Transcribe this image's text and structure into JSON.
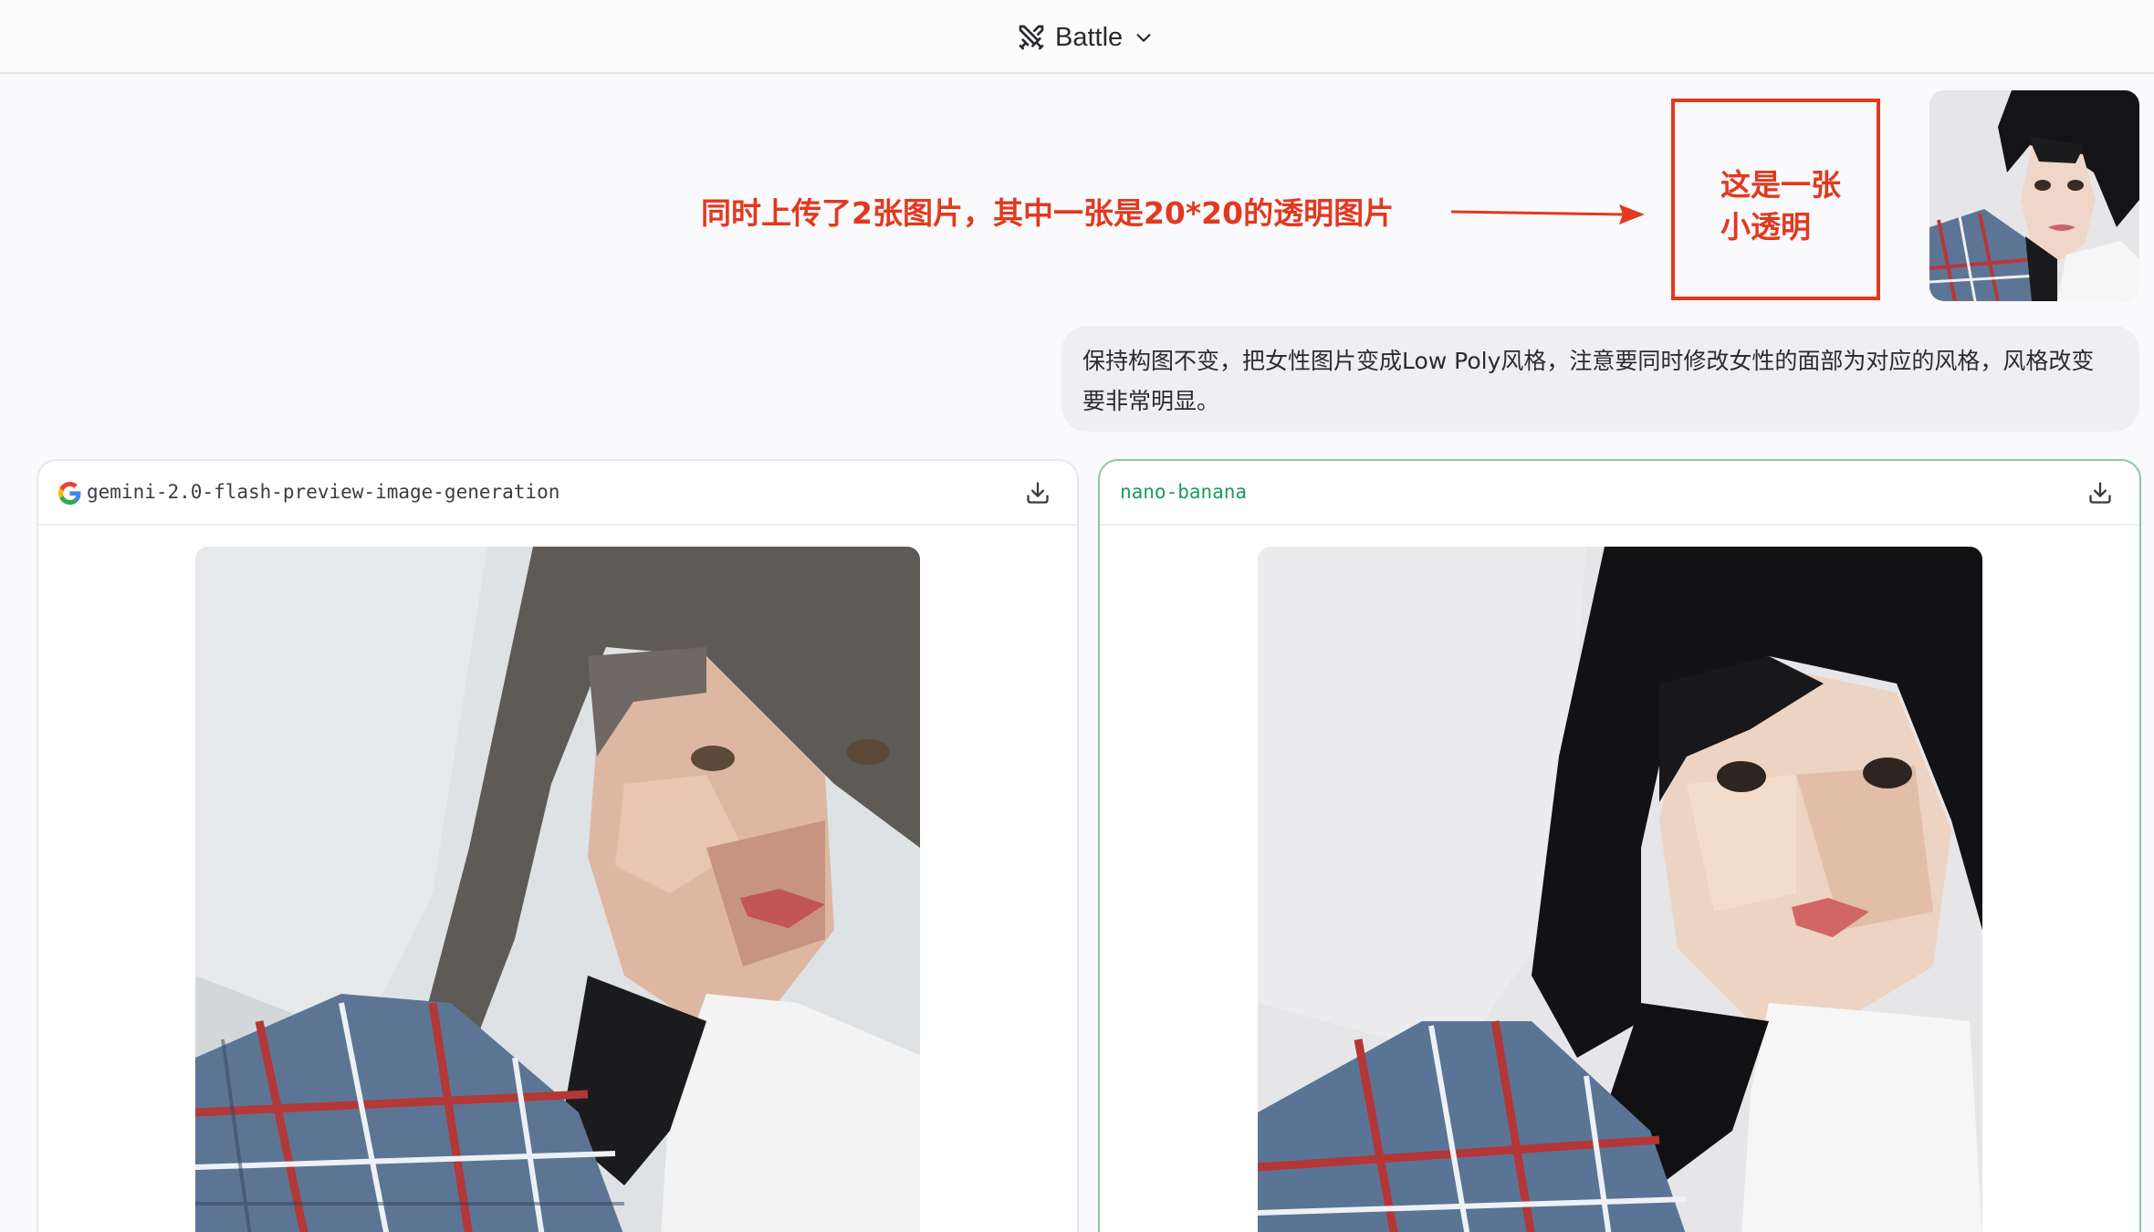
{
  "header": {
    "mode_label": "Battle",
    "mode_icon": "swords-icon"
  },
  "annotation": {
    "note": "同时上传了2张图片，其中一张是20*20的透明图片",
    "box_line1": "这是一张",
    "box_line2": "小透明",
    "color": "#e3381f"
  },
  "prompt": {
    "line1": "保持构图不变，把女性图片变成Low Poly风格，注意要同时修改女性的面部为对应的风格，风格改变",
    "line2": "要非常明显。"
  },
  "cards": [
    {
      "model": "gemini-2.0-flash-preview-image-generation",
      "provider_icon": "google-icon",
      "action_icon": "download-icon"
    },
    {
      "model": "nano-banana",
      "model_color": "#1e9a5c",
      "action_icon": "download-icon"
    }
  ]
}
